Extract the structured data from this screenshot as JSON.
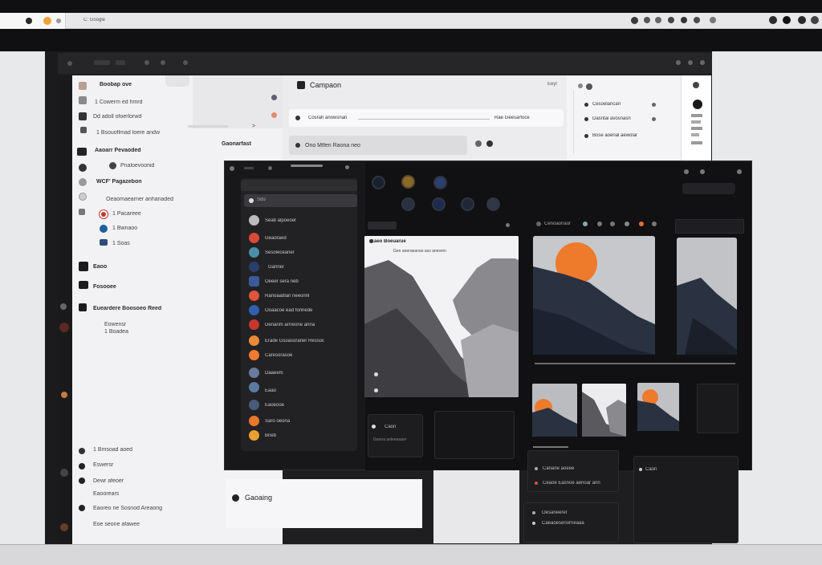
{
  "tabbar": {
    "title": "C: Google"
  },
  "back_sidebar": {
    "header": "Boobap ove",
    "items": [
      "1 Cowerm ed hmrd",
      "Dd adoll ofoerlorwd",
      "1 Bsouoflmad loere andw",
      "Aaoarr Pevaoded",
      "Pnaloevoonid",
      "WCF' Pagazebon",
      "Oeaomaearner anhanaded",
      "1 Pacareee",
      "1 Bwnaoo",
      "1 Soas",
      "Eaoo",
      "Fosooee",
      "Eueardere Boosoeo Reed",
      "Eowensr",
      "1 Boadea",
      "1 Bmsoad aoed",
      "Eswersr",
      "Dewr afeoer",
      "Eaoorears",
      "Eaoreo ne Sosnod Areaong",
      "Eoe seone afawee"
    ],
    "right_label": "Gaonarfast"
  },
  "back_main": {
    "title": "Campaon",
    "row1_left": "Cosrah anowsnan",
    "row1_right": "Rae Geesarfoce",
    "row2": "Ono Mtfen Raona neo",
    "corner": "Eeyl"
  },
  "back_right": {
    "items": [
      "Cesoelancan",
      "Dasntal avosnasn",
      "Bose aoenal aewolar"
    ]
  },
  "front_list": {
    "search": "Sdo",
    "items": [
      "Seab alpoeoer",
      "Geaoraed",
      "Sesoleceaner",
      "Ganner",
      "Oeeer sera neb",
      "Ranoaadlan neeonnl",
      "Ooaacoe ead fonnede",
      "Denanm arrreone anna",
      "Erade Gsoasoraner Ressoc",
      "Caresorasoe",
      "Daaeem",
      "Eaao",
      "Eaoeooe",
      "Saro oeona",
      "Bneb"
    ]
  },
  "front_panels": {
    "img_caption": "Eaeo Boeuarue",
    "img_sub": "Gen aneraeanao ass anesmn",
    "mini_card": "Caon",
    "mini_card_sub": "Ganna aoleeeaaer",
    "toolbar_label": "Cenoaonaor",
    "card1_a": "Canane aoeee",
    "card1_b": "Ceaoe Easnoe aenoar ann",
    "card2_a": "Oesaneerer",
    "card2_b": "Caeaoesenorneaaa",
    "card3": "Caon",
    "dark_tab": "Canaa"
  },
  "bottom_card": {
    "label": "Gaoaing"
  },
  "colors": {
    "accent_orange": "#ee7a2c",
    "dark_bg": "#18181a",
    "light_panel": "#f2f2f4"
  }
}
